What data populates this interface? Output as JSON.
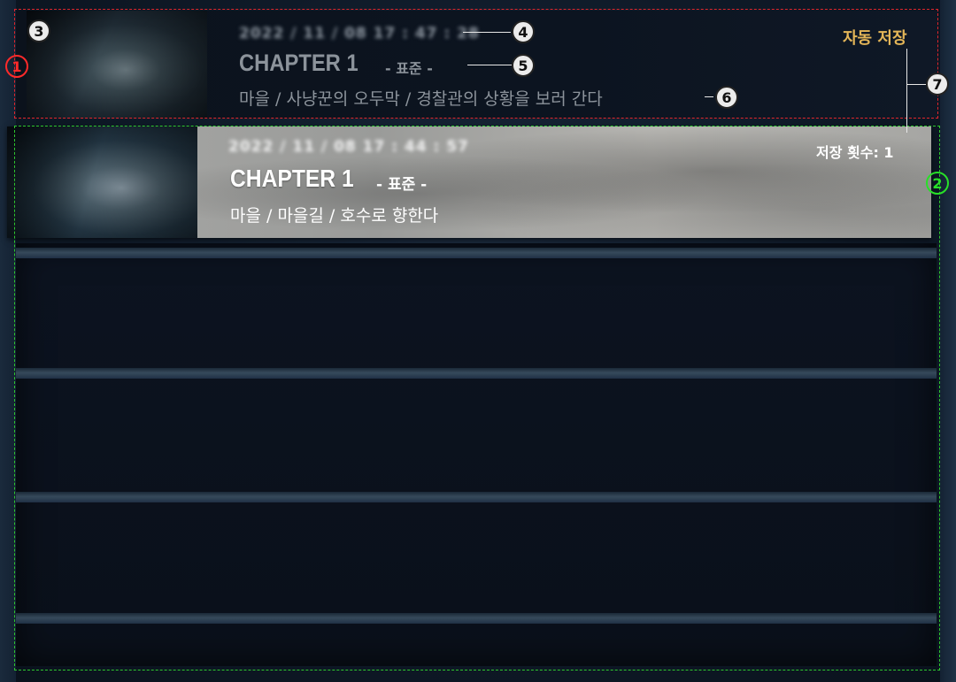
{
  "slot_auto": {
    "datetime": "2022 / 11 / 08    17 : 47 : 28",
    "chapter": "CHAPTER 1",
    "difficulty": "- 표준 -",
    "location": "마을 / 사냥꾼의 오두막 / 경찰관의 상황을 보러 간다",
    "tag": "자동 저장"
  },
  "slot_selected": {
    "datetime": "2022 / 11 / 08    17 : 44 : 57",
    "chapter": "CHAPTER 1",
    "difficulty": "- 표준 -",
    "location": "마을 / 마을길 / 호수로 향한다",
    "save_count": "저장 횟수: 1"
  },
  "callouts": {
    "c1": "1",
    "c2": "2",
    "c3": "3",
    "c4": "4",
    "c5": "5",
    "c6": "6",
    "c7": "7"
  },
  "colors": {
    "autosave_accent": "#e4b658",
    "annotation_red": "#e0262c",
    "annotation_green": "#2ec72e"
  }
}
